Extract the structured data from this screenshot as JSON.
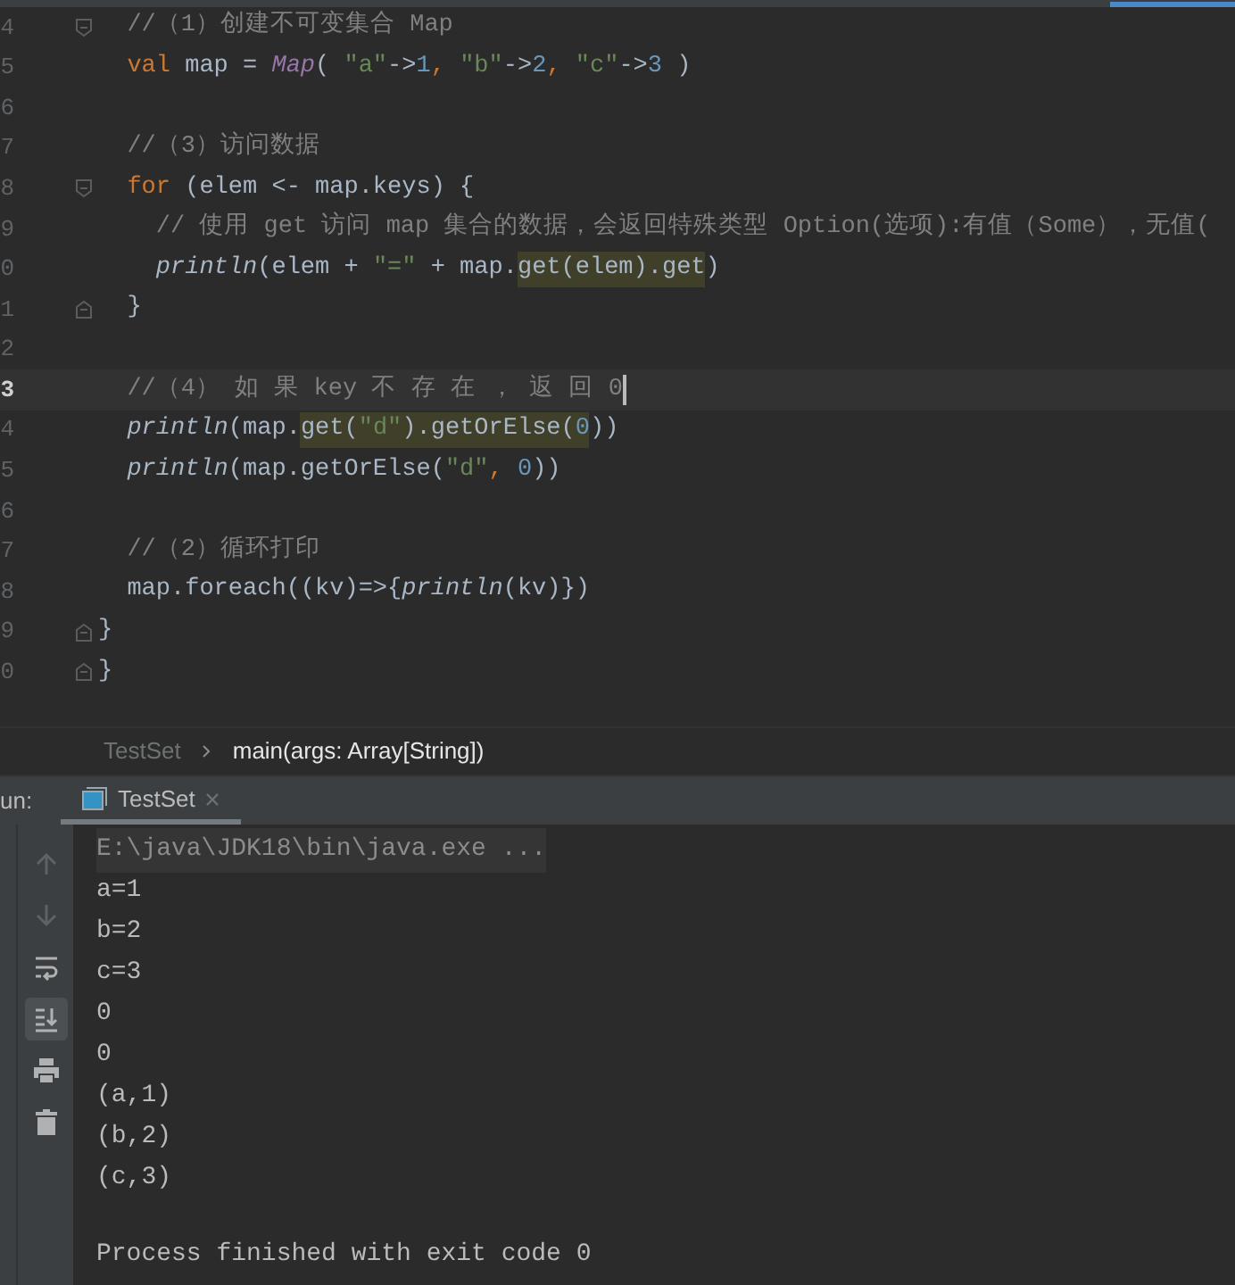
{
  "editor": {
    "lines": [
      {
        "number": "4",
        "current": false,
        "kind": "fold_start",
        "tokens": [
          {
            "text": "  //（1）创建不可变集合 Map",
            "kind": "comment"
          }
        ]
      },
      {
        "number": "5",
        "current": false,
        "kind": "code",
        "tokens": [
          {
            "text": "  val ",
            "kind": "keyword"
          },
          {
            "text": "map = ",
            "kind": "plain"
          },
          {
            "text": "Map",
            "kind": "type"
          },
          {
            "text": "( ",
            "kind": "plain"
          },
          {
            "text": "\"a\"",
            "kind": "string"
          },
          {
            "text": "->",
            "kind": "plain"
          },
          {
            "text": "1",
            "kind": "number"
          },
          {
            "text": ", ",
            "kind": "keyword"
          },
          {
            "text": "\"b\"",
            "kind": "string"
          },
          {
            "text": "->",
            "kind": "plain"
          },
          {
            "text": "2",
            "kind": "number"
          },
          {
            "text": ", ",
            "kind": "keyword"
          },
          {
            "text": "\"c\"",
            "kind": "string"
          },
          {
            "text": "->",
            "kind": "plain"
          },
          {
            "text": "3",
            "kind": "number"
          },
          {
            "text": " )",
            "kind": "plain"
          }
        ]
      },
      {
        "number": "6",
        "current": false,
        "kind": "code"
      },
      {
        "number": "7",
        "current": false,
        "kind": "code",
        "tokens": [
          {
            "text": "  //（3）访问数据",
            "kind": "comment"
          }
        ]
      },
      {
        "number": "8",
        "current": false,
        "kind": "fold_start",
        "tokens": [
          {
            "text": "  for ",
            "kind": "keyword"
          },
          {
            "text": "(elem <- map.keys) {",
            "kind": "plain"
          }
        ]
      },
      {
        "number": "9",
        "current": false,
        "kind": "code",
        "tokens": [
          {
            "text": "    // 使用 get 访问 map 集合的数据，会返回特殊类型 Option(选项):有值（Some），无值(",
            "kind": "comment"
          }
        ]
      },
      {
        "number": "0",
        "current": false,
        "kind": "code",
        "tokens": [
          {
            "text": "    println",
            "kind": "function"
          },
          {
            "text": "(elem + ",
            "kind": "plain"
          },
          {
            "text": "\"=\"",
            "kind": "string"
          },
          {
            "text": " + map.",
            "kind": "plain"
          },
          {
            "kind": "usage",
            "parts": [
              {
                "text": "get(elem).get",
                "kind": "plain"
              }
            ]
          },
          {
            "text": ")",
            "kind": "plain"
          }
        ]
      },
      {
        "number": "1",
        "current": false,
        "kind": "fold_end",
        "tokens": [
          {
            "text": "  }",
            "kind": "plain"
          }
        ]
      },
      {
        "number": "2",
        "current": false,
        "kind": "code"
      },
      {
        "number": "3",
        "current": true,
        "kind": "code",
        "tokens": [
          {
            "text": "  //（4） 如 果 key 不 存 在 ， 返 回 0",
            "kind": "comment"
          }
        ]
      },
      {
        "number": "4",
        "current": false,
        "kind": "code",
        "tokens": [
          {
            "text": "  println",
            "kind": "function"
          },
          {
            "text": "(map.",
            "kind": "plain"
          },
          {
            "kind": "usage",
            "parts": [
              {
                "text": "get(",
                "kind": "plain"
              },
              {
                "text": "\"d\"",
                "kind": "string"
              },
              {
                "text": ").getOrElse(",
                "kind": "plain"
              },
              {
                "text": "0",
                "kind": "number"
              }
            ]
          },
          {
            "text": "))",
            "kind": "plain"
          }
        ]
      },
      {
        "number": "5",
        "current": false,
        "kind": "code",
        "tokens": [
          {
            "text": "  println",
            "kind": "function"
          },
          {
            "text": "(map.getOrElse(",
            "kind": "plain"
          },
          {
            "text": "\"d\"",
            "kind": "string"
          },
          {
            "text": ", ",
            "kind": "keyword"
          },
          {
            "text": "0",
            "kind": "number"
          },
          {
            "text": "))",
            "kind": "plain"
          }
        ]
      },
      {
        "number": "6",
        "current": false,
        "kind": "code"
      },
      {
        "number": "7",
        "current": false,
        "kind": "code",
        "tokens": [
          {
            "text": "  //（2）循环打印",
            "kind": "comment"
          }
        ]
      },
      {
        "number": "8",
        "current": false,
        "kind": "code",
        "tokens": [
          {
            "text": "  map.foreach((kv)=>{",
            "kind": "plain"
          },
          {
            "text": "println",
            "kind": "function"
          },
          {
            "text": "(kv)})",
            "kind": "plain"
          }
        ]
      },
      {
        "number": "9",
        "current": false,
        "kind": "fold_end",
        "tokens": [
          {
            "text": "}",
            "kind": "plain"
          }
        ]
      },
      {
        "number": "0",
        "current": false,
        "kind": "fold_end",
        "tokens": [
          {
            "text": "}",
            "kind": "plain"
          }
        ]
      }
    ]
  },
  "breadcrumb": [
    "TestSet",
    "main(args: Array[String])"
  ],
  "run_panel": {
    "label": "un:",
    "tabs": [
      {
        "label": "TestSet",
        "selected": true
      }
    ],
    "toolbar": [
      {
        "kind": "up",
        "disabled": true,
        "active": false
      },
      {
        "kind": "down",
        "disabled": true,
        "active": false
      },
      {
        "kind": "wrap",
        "disabled": false,
        "active": false
      },
      {
        "kind": "scroll_end",
        "disabled": false,
        "active": true
      },
      {
        "kind": "print",
        "disabled": false,
        "active": false
      },
      {
        "kind": "delete",
        "disabled": false,
        "active": false
      }
    ],
    "console": [
      {
        "text": "E:\\java\\JDK18\\bin\\java.exe ...",
        "kind": "command"
      },
      {
        "text": "a=1",
        "kind": "output"
      },
      {
        "text": "b=2",
        "kind": "output"
      },
      {
        "text": "c=3",
        "kind": "output"
      },
      {
        "text": "0",
        "kind": "output"
      },
      {
        "text": "0",
        "kind": "output"
      },
      {
        "text": "(a,1)",
        "kind": "output"
      },
      {
        "text": "(b,2)",
        "kind": "output"
      },
      {
        "text": "(c,3)",
        "kind": "output"
      },
      {
        "text": "Process finished with exit code 0",
        "kind": "exit"
      }
    ]
  }
}
